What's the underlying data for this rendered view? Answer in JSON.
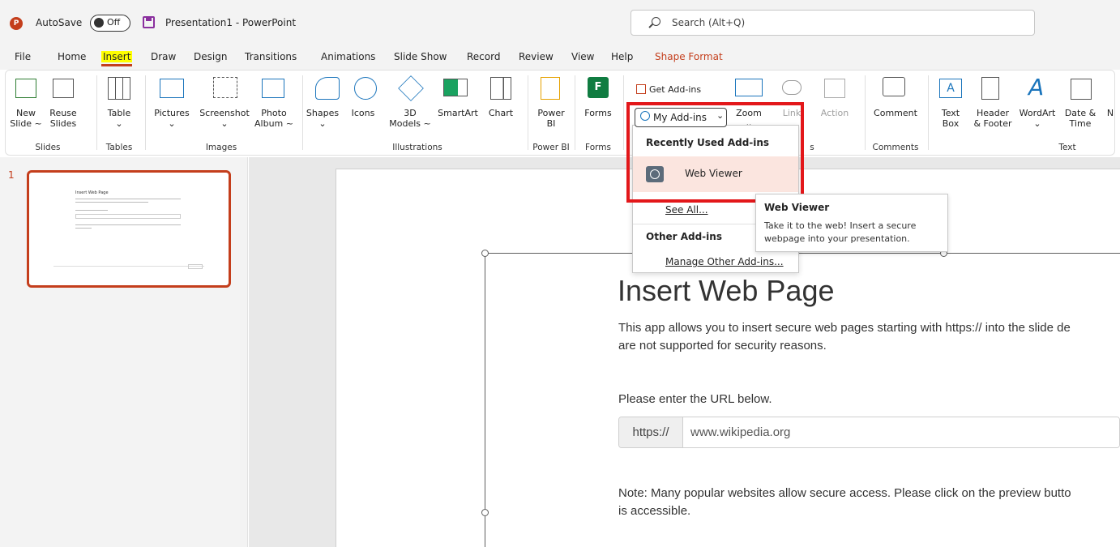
{
  "titlebar": {
    "autosave_label": "AutoSave",
    "autosave_state": "Off",
    "document_title": "Presentation1  -  PowerPoint",
    "search_placeholder": "Search (Alt+Q)"
  },
  "menu": [
    "File",
    "Home",
    "Insert",
    "Draw",
    "Design",
    "Transitions",
    "Animations",
    "Slide Show",
    "Record",
    "Review",
    "View",
    "Help",
    "Shape Format"
  ],
  "ribbon": {
    "slides": {
      "new_slide_1": "New",
      "new_slide_2": "Slide ~",
      "reuse_1": "Reuse",
      "reuse_2": "Slides",
      "label": "Slides"
    },
    "tables": {
      "table": "Table",
      "label": "Tables"
    },
    "images": {
      "pictures": "Pictures",
      "screenshot": "Screenshot",
      "photo_album_1": "Photo",
      "photo_album_2": "Album ~",
      "label": "Images"
    },
    "illustrations": {
      "shapes": "Shapes",
      "icons": "Icons",
      "models_1": "3D",
      "models_2": "Models ~",
      "smartart": "SmartArt",
      "chart": "Chart",
      "label": "Illustrations"
    },
    "powerbi": {
      "power_1": "Power",
      "power_2": "BI",
      "label": "Power BI"
    },
    "forms": {
      "forms": "Forms",
      "label": "Forms"
    },
    "addins": {
      "get_addins": "Get Add-ins",
      "my_addins": "My Add-ins"
    },
    "links": {
      "zoom": "Zoom",
      "link": "Link",
      "action": "Action",
      "label": "s"
    },
    "comments": {
      "comment": "Comment",
      "label": "Comments"
    },
    "text": {
      "textbox_1": "Text",
      "textbox_2": "Box",
      "header_1": "Header",
      "header_2": "& Footer",
      "wordart": "WordArt",
      "date_1": "Date &",
      "date_2": "Time",
      "more": "N",
      "label": "Text"
    }
  },
  "dropdown": {
    "recent_heading": "Recently Used Add-ins",
    "web_viewer": "Web Viewer",
    "see_all": "See All...",
    "other_heading": "Other Add-ins",
    "manage": "Manage Other Add-ins..."
  },
  "tooltip": {
    "title": "Web Viewer",
    "text": "Take it to the web! Insert a secure webpage into your presentation."
  },
  "slide_pane": {
    "slide_number": "1"
  },
  "slide": {
    "title": "Insert Web Page",
    "desc_line1": "This app allows you to insert secure web pages starting with https:// into the slide de",
    "desc_line2": "are not supported for security reasons.",
    "prompt": "Please enter the URL below.",
    "url_prefix": "https://",
    "url_value": "www.wikipedia.org",
    "note_line1": "Note: Many popular websites allow secure access. Please click on the preview butto",
    "note_line2": "is accessible."
  },
  "colors": {
    "accent": "#c43e1c",
    "highlight_box": "#e3171a",
    "insert_highlight": "#ffff00"
  }
}
